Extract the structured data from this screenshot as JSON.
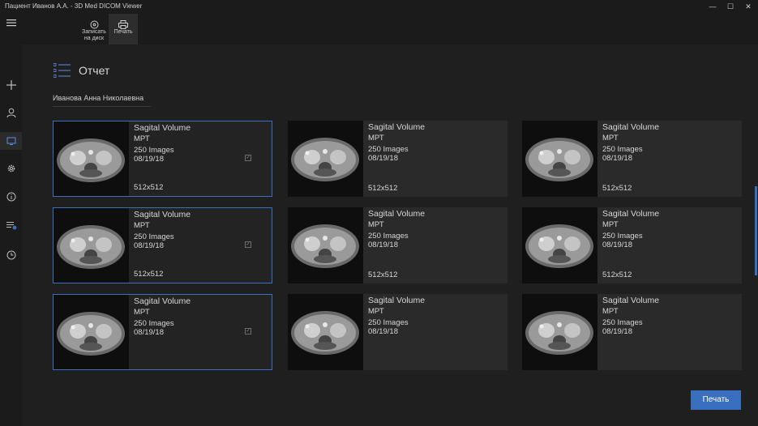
{
  "window": {
    "title": "Пациент Иванов А.А. - 3D Med DICOM Viewer",
    "minimize_glyph": "—",
    "maximize_glyph": "☐",
    "close_glyph": "✕"
  },
  "toolbar": {
    "burn_label_line1": "Записать",
    "burn_label_line2": "на диск",
    "print_label": "Печать"
  },
  "sidebar": {
    "icons": [
      "menu-icon",
      "plus-icon",
      "user-icon",
      "monitor-icon",
      "gear-icon",
      "info-icon",
      "list-badge-icon",
      "clock-icon"
    ],
    "active_index": 3
  },
  "report": {
    "title": "Отчет",
    "patient_name": "Иванова Анна Николаевна"
  },
  "cards": [
    {
      "title": "Sagital Volume",
      "modality": "МРТ",
      "images": "250 Images",
      "date": "08/19/18",
      "resolution": "512x512",
      "selected": true
    },
    {
      "title": "Sagital Volume",
      "modality": "МРТ",
      "images": "250 Images",
      "date": "08/19/18",
      "resolution": "512x512",
      "selected": false
    },
    {
      "title": "Sagital Volume",
      "modality": "МРТ",
      "images": "250 Images",
      "date": "08/19/18",
      "resolution": "512x512",
      "selected": false
    },
    {
      "title": "Sagital Volume",
      "modality": "МРТ",
      "images": "250 Images",
      "date": "08/19/18",
      "resolution": "512x512",
      "selected": true
    },
    {
      "title": "Sagital Volume",
      "modality": "МРТ",
      "images": "250 Images",
      "date": "08/19/18",
      "resolution": "512x512",
      "selected": false
    },
    {
      "title": "Sagital Volume",
      "modality": "МРТ",
      "images": "250 Images",
      "date": "08/19/18",
      "resolution": "512x512",
      "selected": false
    },
    {
      "title": "Sagital Volume",
      "modality": "МРТ",
      "images": "250 Images",
      "date": "08/19/18",
      "resolution": "",
      "selected": true
    },
    {
      "title": "Sagital Volume",
      "modality": "МРТ",
      "images": "250 Images",
      "date": "08/19/18",
      "resolution": "",
      "selected": false
    },
    {
      "title": "Sagital Volume",
      "modality": "МРТ",
      "images": "250 Images",
      "date": "08/19/18",
      "resolution": "",
      "selected": false
    }
  ],
  "footer": {
    "print_button": "Печать"
  },
  "colors": {
    "accent": "#3a6fc0",
    "background": "#1f1f1f",
    "card": "#2a2a2a"
  }
}
